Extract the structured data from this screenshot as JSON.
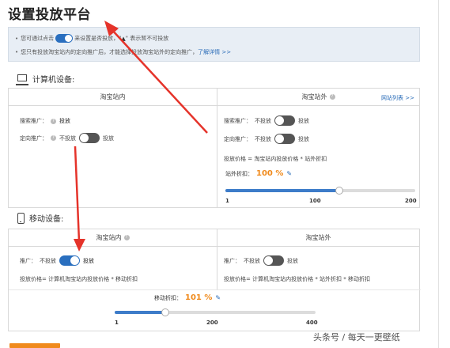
{
  "page": {
    "title": "设置投放平台"
  },
  "notice": {
    "line1_a": "您可通过点击",
    "line1_b": "来设置是否投放，\"",
    "line1_c": "\" 表示暂不可投放",
    "line2_text": "您只有投放淘宝站内的定向推广后，才能选择投放淘宝站外的定向推广，",
    "line2_link": "了解详情 >>"
  },
  "pc": {
    "section_label": "计算机设备:",
    "left": {
      "header": "淘宝站内",
      "search_label": "搜索推广：",
      "search_value": "投放",
      "targeted_label": "定向推广：",
      "targeted_off": "不投放",
      "targeted_on": "投放"
    },
    "right": {
      "header": "淘宝站外",
      "site_list_link": "网站列表 >>",
      "search_label": "搜索推广：",
      "search_off": "不投放",
      "search_on": "投放",
      "targeted_label": "定向推广：",
      "targeted_off": "不投放",
      "targeted_on": "投放",
      "price_formula": "投放价格 = 淘宝站内投放价格 * 站外折扣",
      "discount_label": "站外折扣：",
      "discount_value": "100 %",
      "slider_value_fraction": 0.6,
      "ticks": [
        "1",
        "100",
        "200"
      ]
    }
  },
  "mobile": {
    "section_label": "移动设备:",
    "left": {
      "header": "淘宝站内",
      "promo_label": "推广：",
      "promo_off": "不投放",
      "promo_on": "投放",
      "price_formula": "投放价格= 计算机淘宝站内投放价格 * 移动折扣"
    },
    "right": {
      "header": "淘宝站外",
      "promo_label": "推广：",
      "promo_off": "不投放",
      "promo_on": "投放",
      "price_formula": "投放价格= 计算机淘宝站内投放价格 * 站外折扣 * 移动折扣"
    },
    "discount_label": "移动折扣：",
    "discount_value": "101 %",
    "slider_value_fraction": 0.25,
    "ticks": [
      "1",
      "200",
      "400"
    ]
  },
  "watermark": "头条号 / 每天一更壁纸",
  "colors": {
    "accent_blue": "#2a6fbf",
    "discount_orange": "#f08a1c",
    "arrow_red": "#e5332a"
  }
}
